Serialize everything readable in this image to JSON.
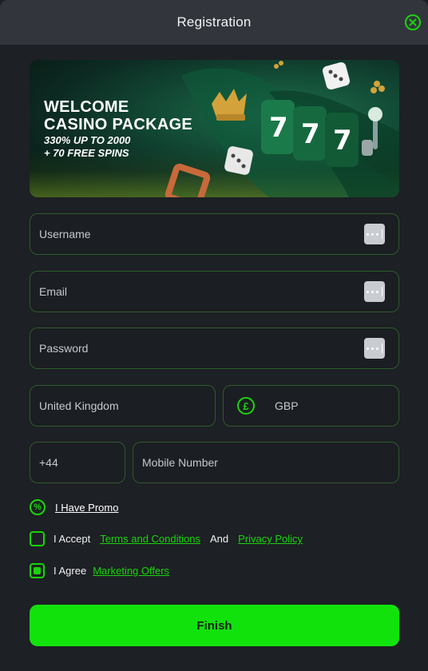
{
  "header": {
    "title": "Registration"
  },
  "banner": {
    "line1": "WELCOME",
    "line2": "CASINO PACKAGE",
    "line3": "330% UP TO 2000",
    "line4": "+ 70 FREE SPINS"
  },
  "form": {
    "username_placeholder": "Username",
    "email_placeholder": "Email",
    "password_placeholder": "Password",
    "country_value": "United Kingdom",
    "currency_symbol": "£",
    "currency_value": "GBP",
    "phone_code": "+44",
    "mobile_placeholder": "Mobile Number"
  },
  "promo": {
    "icon_glyph": "%",
    "label": "I Have Promo"
  },
  "consent": {
    "terms": {
      "prefix": "I Accept",
      "terms_link": "Terms and Conditions",
      "conjunction": "And",
      "privacy_link": "Privacy Policy",
      "checked": false
    },
    "marketing": {
      "prefix": "I Agree",
      "link": "Marketing Offers",
      "checked": true
    }
  },
  "actions": {
    "finish_label": "Finish"
  },
  "colors": {
    "accent": "#19d40b",
    "button": "#12e20c",
    "background": "#1d2024",
    "header": "#32363c",
    "field_border": "#2f5a2c"
  },
  "icons": {
    "close": "close-icon",
    "password_manager": "password-manager-icon",
    "currency": "pound-icon",
    "promo": "promo-icon"
  }
}
